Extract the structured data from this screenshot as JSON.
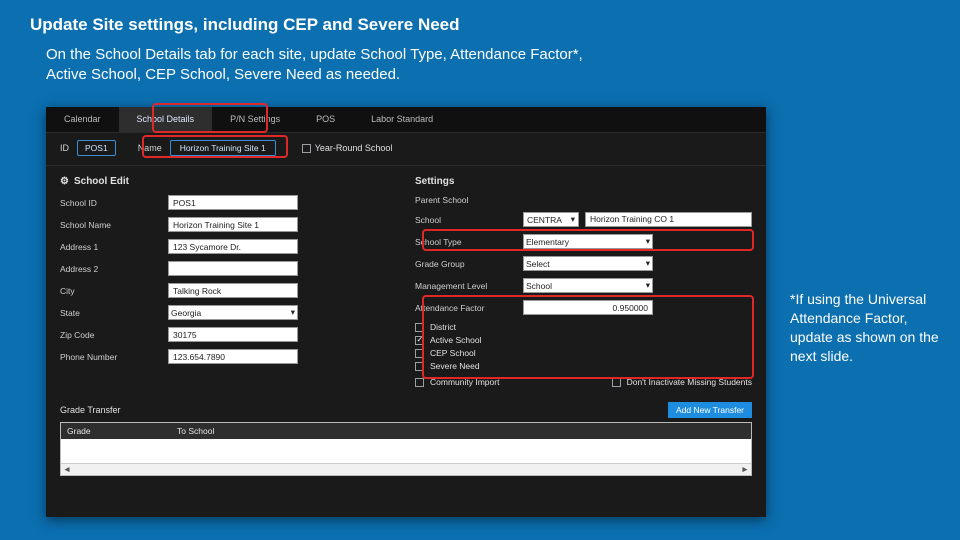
{
  "slide": {
    "title": "Update Site settings, including CEP and Severe Need",
    "intro": "On the School Details tab for each site, update School Type, Attendance Factor*, Active School, CEP School, Severe Need as needed.",
    "sidenote": "*If using the Universal Attendance Factor, update as shown on the next slide."
  },
  "tabs": {
    "items": [
      "Calendar",
      "School Details",
      "P/N Settings",
      "POS",
      "Labor Standard"
    ],
    "active_index": 1
  },
  "idrow": {
    "id_label": "ID",
    "id_value": "POS1",
    "name_label": "Name",
    "name_value": "Horizon Training Site 1",
    "year_round_label": "Year-Round School"
  },
  "left": {
    "section": "School Edit",
    "school_id_label": "School ID",
    "school_id": "POS1",
    "school_name_label": "School Name",
    "school_name": "Horizon Training Site 1",
    "address1_label": "Address 1",
    "address1": "123 Sycamore Dr.",
    "address2_label": "Address 2",
    "address2": "",
    "city_label": "City",
    "city": "Talking Rock",
    "state_label": "State",
    "state": "Georgia",
    "zip_label": "Zip Code",
    "zip": "30175",
    "phone_label": "Phone Number",
    "phone": "123.654.7890"
  },
  "right": {
    "section": "Settings",
    "parent_label": "Parent School",
    "school_label": "School",
    "school_dropdown": "CENTRA",
    "school_value": "Horizon Training CO 1",
    "type_label": "School Type",
    "type_value": "Elementary",
    "grade_label": "Grade Group",
    "grade_value": "Select",
    "mgmt_label": "Management Level",
    "mgmt_value": "School",
    "att_label": "Attendance Factor",
    "att_value": "0.950000",
    "district_label": "District",
    "active_label": "Active School",
    "cep_label": "CEP School",
    "severe_label": "Severe Need",
    "community_label": "Community Import",
    "dont_inactivate_label": "Don't Inactivate Missing Students"
  },
  "gt": {
    "title": "Grade Transfer",
    "add_btn": "Add New Transfer",
    "col_grade": "Grade",
    "col_to": "To School"
  }
}
